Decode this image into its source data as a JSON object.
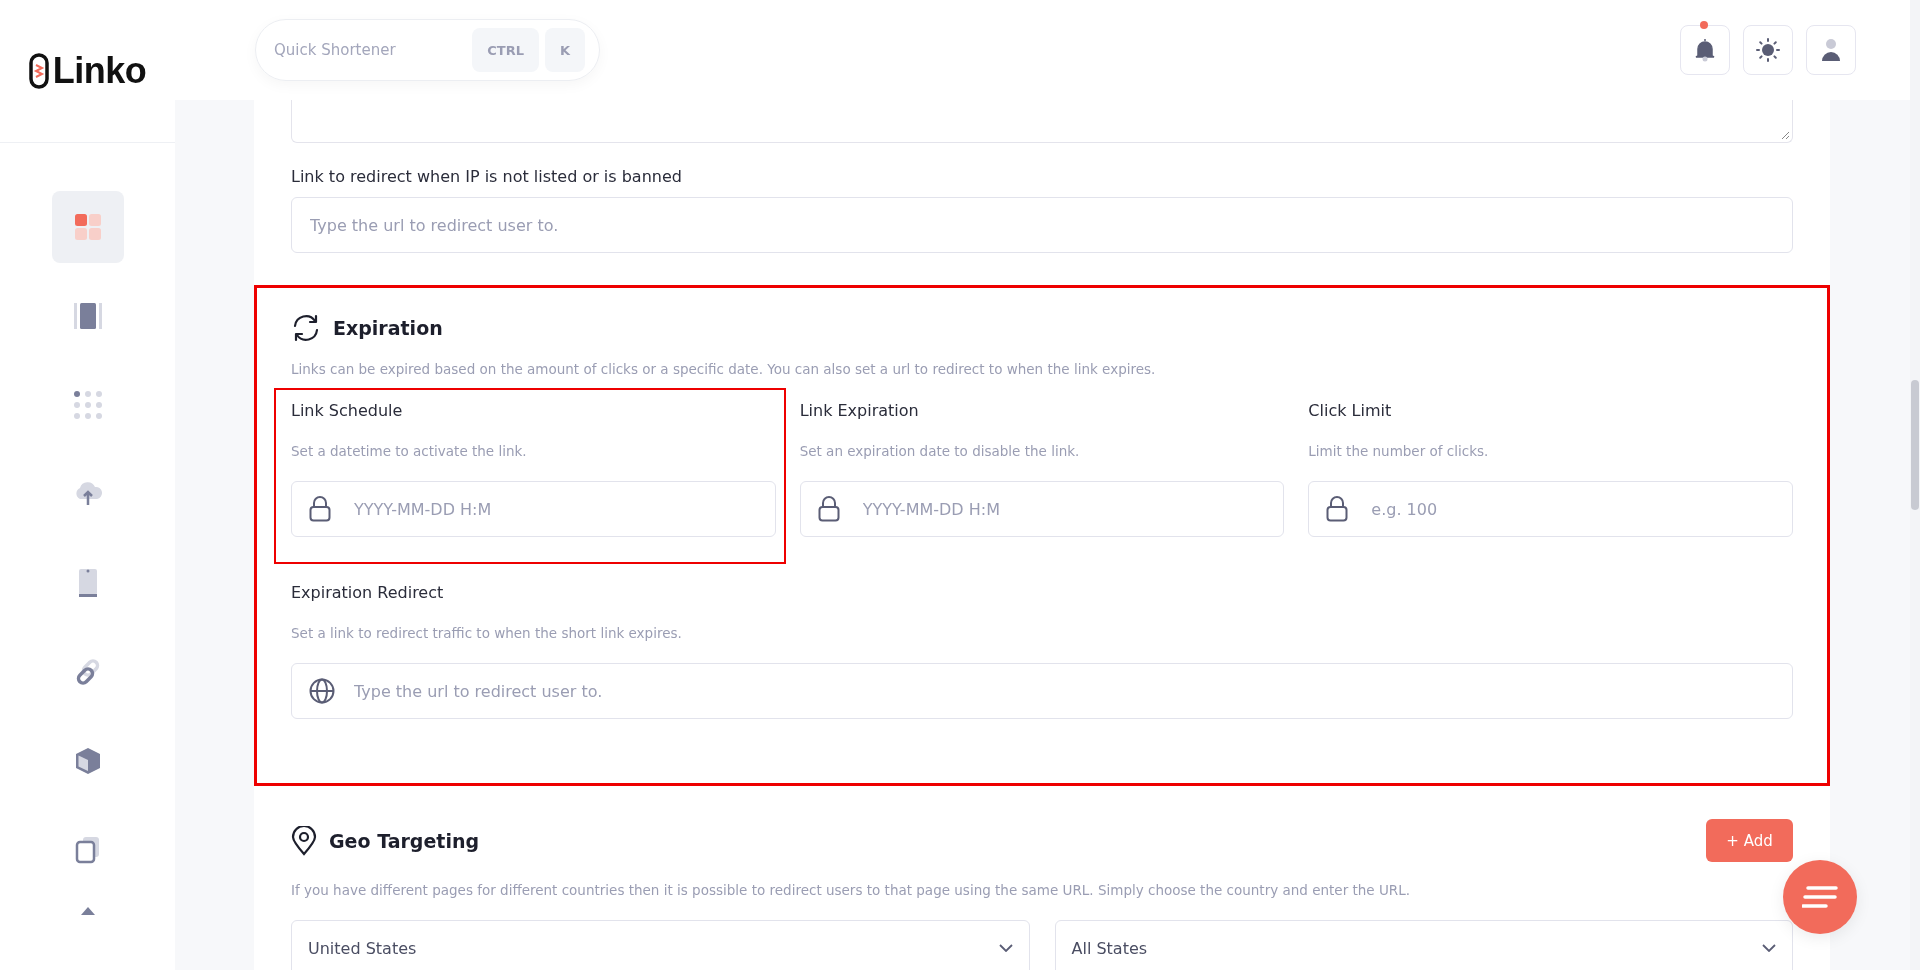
{
  "brand": {
    "name": "Linko"
  },
  "sidebar": {
    "items": [
      {
        "selected": true
      },
      {
        "selected": false
      },
      {
        "selected": false
      },
      {
        "selected": false
      },
      {
        "selected": false
      },
      {
        "selected": false
      },
      {
        "selected": false
      },
      {
        "selected": false
      }
    ]
  },
  "header": {
    "quick_shortener": {
      "placeholder": "Quick Shortener",
      "keys": [
        "CTRL",
        "K"
      ]
    },
    "notifications": {
      "unread": true
    }
  },
  "ip_redirect": {
    "label": "Link to redirect when IP is not listed or is banned",
    "placeholder": "Type the url to redirect user to."
  },
  "expiration": {
    "title": "Expiration",
    "highlighted": true,
    "description": "Links can be expired based on the amount of clicks or a specific date. You can also set a url to redirect to when the link expires.",
    "fields": [
      {
        "label": "Link Schedule",
        "hint": "Set a datetime to activate the link.",
        "placeholder": "YYYY-MM-DD H:M",
        "highlighted": true
      },
      {
        "label": "Link Expiration",
        "hint": "Set an expiration date to disable the link.",
        "placeholder": "YYYY-MM-DD H:M",
        "highlighted": false
      },
      {
        "label": "Click Limit",
        "hint": "Limit the number of clicks.",
        "placeholder": "e.g. 100",
        "highlighted": false
      }
    ],
    "redirect": {
      "label": "Expiration Redirect",
      "hint": "Set a link to redirect traffic to when the short link expires.",
      "placeholder": "Type the url to redirect user to."
    }
  },
  "geo_targeting": {
    "title": "Geo Targeting",
    "add_button": "+ Add",
    "description": "If you have different pages for different countries then it is possible to redirect users to that page using the same URL. Simply choose the country and enter the URL.",
    "rows": [
      {
        "country": "United States",
        "state": "All States"
      }
    ]
  }
}
